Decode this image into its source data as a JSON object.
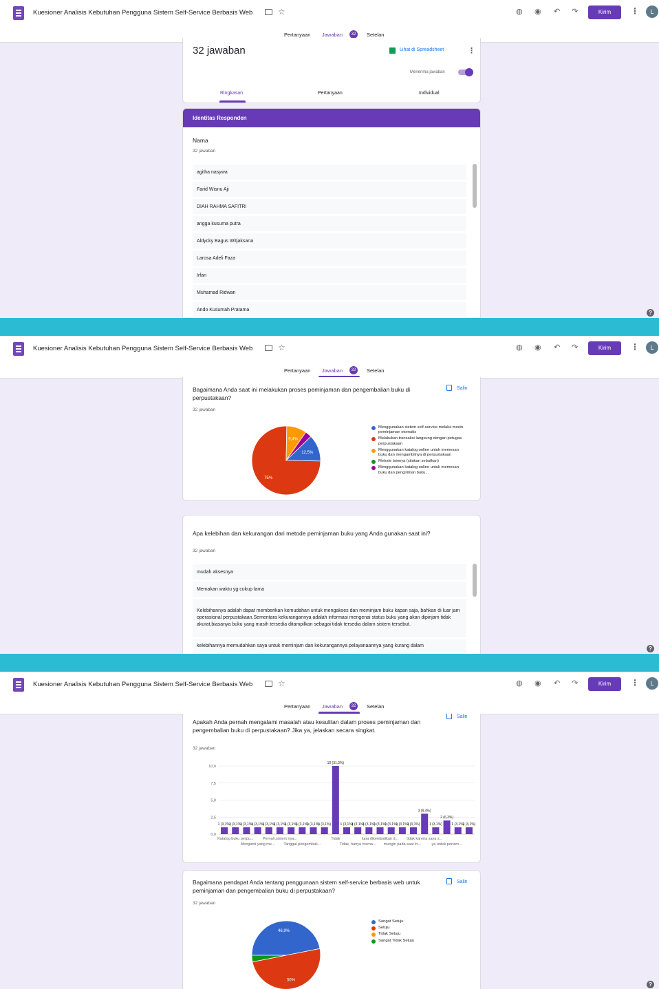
{
  "toolbar": {
    "title": "Kuesioner Analisis Kebutuhan Pengguna Sistem Self-Service Berbasis Web",
    "send_label": "Kirim",
    "avatar_letter": "L",
    "icons": [
      "palette-icon",
      "preview-eye-icon",
      "undo-icon",
      "redo-icon",
      "more-vert-icon",
      "folder-icon",
      "star-icon"
    ]
  },
  "tabs": {
    "questions": "Pertanyaan",
    "responses": "Jawaban",
    "responses_count": "32",
    "settings": "Setelan"
  },
  "summary": {
    "heading": "32 jawaban",
    "sheets_link": "Lihat di Spreadsheet",
    "accepting_label": "Menerima jawaban",
    "accepting": true,
    "subtabs": [
      "Ringkasan",
      "Pertanyaan",
      "Individual"
    ],
    "active_subtab": "Ringkasan"
  },
  "section": {
    "title": "Identitas Responden"
  },
  "q_name": {
    "title": "Nama",
    "count": "32 jawaban",
    "responses": [
      "agitha nasywa",
      "Farid Wisnu Aji",
      "DIAH RAHMA SAFITRI",
      "angga kusuma putra",
      "Aldycky Bagus Witjaksana",
      "Larosa Adeli Faza",
      "Irfan",
      "Muhamad Ridwan",
      "Ando Kusumah Pratama"
    ]
  },
  "q_method": {
    "title": "Bagaimana Anda saat ini melakukan proses peminjaman dan pengembalian buku di perpustakaan?",
    "count": "32 jawaban",
    "copy_label": "Salin"
  },
  "q_pros_cons": {
    "title": "Apa kelebihan dan kekurangan dari metode peminjaman buku yang Anda gunakan saat ini?",
    "count": "32 jawaban",
    "responses": [
      "mudah aksesnya",
      "Memakan waktu yg cukup lama",
      "Kelebihannya adalah dapat memberikan kemudahan untuk mengakses dan meminjam buku kapan saja, bahkan di luar jam operasional perpustakaan.Sementara kekurangannya adalah informasi mengenai status buku yang akan dipinjam tidak akurat,biasanya buku yang masih tersedia ditampilkan sebagai tidak tersedia dalam sistem tersebut.",
      "kelebihannya memudahkan saya untuk meminjam dan kekurangannya pelayanaannya yang kurang dalam"
    ]
  },
  "q_problems": {
    "title": "Apakah Anda pernah mengalami masalah atau kesulitan dalam proses peminjaman dan pengembalian buku di perpustakaan? Jika ya, jelaskan secara singkat.",
    "count": "32 jawaban",
    "copy_label": "Salin"
  },
  "q_opinion": {
    "title": "Bagaimana pendapat Anda tentang penggunaan sistem self-service berbasis web untuk peminjaman dan pengembalian buku di perpustakaan?",
    "count": "32 jawaban",
    "copy_label": "Salin"
  },
  "help_label": "?",
  "colors": {
    "accent": "#673ab7",
    "background": "#f0ebf8",
    "blue": "#3366cc",
    "red": "#dc3912",
    "orange": "#ff9900",
    "green": "#109618",
    "purple": "#990099",
    "sheets_green": "#0f9d58"
  },
  "chart_data": [
    {
      "type": "pie",
      "slices": [
        {
          "label": "Menggunakan sistem self-service melalui mesin peminjaman otomatis",
          "value": 12.5,
          "display": "12,5%",
          "color": "#3366cc"
        },
        {
          "label": "Melakukan transaksi langsung dengan petugas perpustakaan",
          "value": 75,
          "display": "75%",
          "color": "#dc3912"
        },
        {
          "label": "Menggunakan katalog online untuk memesan buku dan mengambilnya di perpustakaan",
          "value": 9.4,
          "display": "9,4%",
          "color": "#ff9900"
        },
        {
          "label": "Metode lainnya (silakan sebutkan)",
          "value": 0,
          "display": "",
          "color": "#109618"
        },
        {
          "label": "Menggunakan katalog online untuk memesan buku dan pengiriman buku...",
          "value": 3.1,
          "display": "",
          "color": "#990099"
        }
      ]
    },
    {
      "type": "bar",
      "ylim": [
        0,
        10
      ],
      "yticks": [
        "0,0",
        "2,5",
        "5,0",
        "7,5",
        "10,0"
      ],
      "values": [
        1,
        1,
        1,
        1,
        1,
        1,
        1,
        1,
        1,
        1,
        10,
        1,
        1,
        1,
        1,
        1,
        1,
        1,
        3,
        1,
        2,
        1,
        1
      ],
      "data_labels": [
        "1 (3,1%)",
        "1 (3,1%)",
        "1 (3,1%)",
        "1 (3,1%)",
        "1 (3,1%)",
        "1 (3,1%)",
        "1 (3,1%)",
        "1 (3,1%)",
        "1 (3,1%)",
        "1 (3,1%)",
        "10 (31,3%)",
        "1 (3,1%)",
        "1 (3,1%)",
        "1 (3,1%)",
        "1 (3,1%)",
        "1 (3,1%)",
        "1 (3,1%)",
        "1 (3,1%)",
        "3 (9,4%)",
        "1 (3,1%)",
        "2 (6,3%)",
        "1 (3,1%)",
        "1 (3,1%)"
      ],
      "xlabels_row1": [
        "Katalog buku perpu...",
        "Pernah,sistem nya...",
        "Tidak",
        "lupa dikembalikan d...",
        "tidak karena saya s..."
      ],
      "xlabels_row2": [
        "Menganti yang me...",
        "Tanggal pengembali...",
        "Tidak, hanya mema...",
        "mungin pada saat in...",
        "ya untuk pertam..."
      ],
      "color": "#673ab7"
    },
    {
      "type": "pie",
      "slices": [
        {
          "label": "Sangat Setuju",
          "value": 46.9,
          "display": "46,9%",
          "color": "#3366cc"
        },
        {
          "label": "Setuju",
          "value": 50,
          "display": "50%",
          "color": "#dc3912"
        },
        {
          "label": "Tidak Setuju",
          "value": 0,
          "display": "",
          "color": "#ff9900"
        },
        {
          "label": "Sangat Tidak Setuju",
          "value": 3.1,
          "display": "",
          "color": "#109618"
        }
      ]
    }
  ]
}
